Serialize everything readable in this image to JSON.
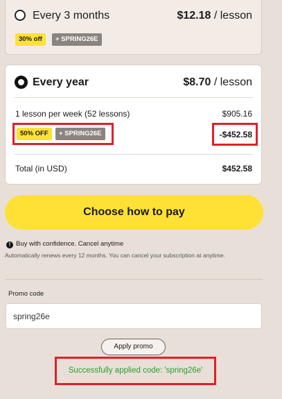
{
  "plans": {
    "quarterly": {
      "name": "Every 3 months",
      "price": "$12.18",
      "price_unit": "/ lesson",
      "discount_badge": "30% off",
      "code_badge": "+ SPRING26E"
    },
    "yearly": {
      "name": "Every year",
      "price": "$8.70",
      "price_unit": "/ lesson",
      "lessons_text": "1 lesson per week (52 lessons)",
      "lessons_amount": "$905.16",
      "discount_badge": "50% OFF",
      "code_badge": "+ SPRING26E",
      "discount_amount": "-$452.58",
      "total_label": "Total (in USD)",
      "total_amount": "$452.58"
    }
  },
  "pay_button": "Choose how to pay",
  "confidence_text": "Buy with confidence. Cancel anytime",
  "renew_text": "Automatically renews every 12 months. You can cancel your subscription at anytime.",
  "promo": {
    "label": "Promo code",
    "value": "spring26e",
    "apply_label": "Apply promo",
    "success_message": "Successfully applied code: 'spring26e'"
  },
  "colors": {
    "accent_yellow": "#ffe135",
    "success_green": "#2e9a30",
    "highlight_red": "#e0202a",
    "background": "#e8e0d8"
  }
}
